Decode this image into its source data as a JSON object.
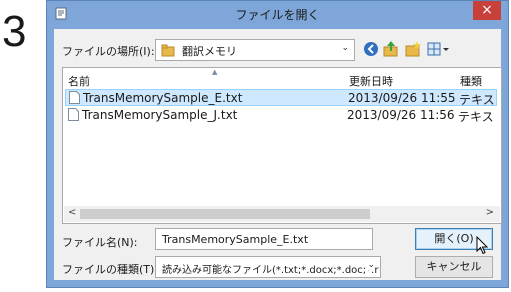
{
  "step_number": "3",
  "window": {
    "title": "ファイルを開く",
    "close_symbol": "×"
  },
  "look_in": {
    "label": "ファイルの場所(I):",
    "value": "翻訳メモリ",
    "dropdown_symbol": "⌄"
  },
  "file_list": {
    "columns": [
      "名前",
      "更新日時",
      "種類"
    ],
    "rows": [
      {
        "name": "TransMemorySample_E.txt",
        "modified": "2013/09/26 11:55",
        "type": "テキス",
        "selected": true
      },
      {
        "name": "TransMemorySample_J.txt",
        "modified": "2013/09/26 11:56",
        "type": "テキス",
        "selected": false
      }
    ],
    "scroll_left": "<",
    "scroll_right": ">"
  },
  "file_name": {
    "label": "ファイル名(N):",
    "value": "TransMemorySample_E.txt"
  },
  "file_type": {
    "label": "ファイルの種類(T):",
    "value": "読み込み可能なファイル(*.txt;*.docx;*.doc;*.r",
    "dropdown_symbol": "⌄"
  },
  "buttons": {
    "open": "開く(O)",
    "cancel": "キャンセル"
  },
  "colors": {
    "frame": "#7ea6d8",
    "close": "#c8403a",
    "selection": "#cde8ff"
  },
  "icons": [
    "app-icon",
    "folder-icon",
    "back-icon",
    "up-folder-icon",
    "new-folder-icon",
    "view-menu-icon",
    "text-file-icon",
    "mouse-cursor-icon"
  ]
}
